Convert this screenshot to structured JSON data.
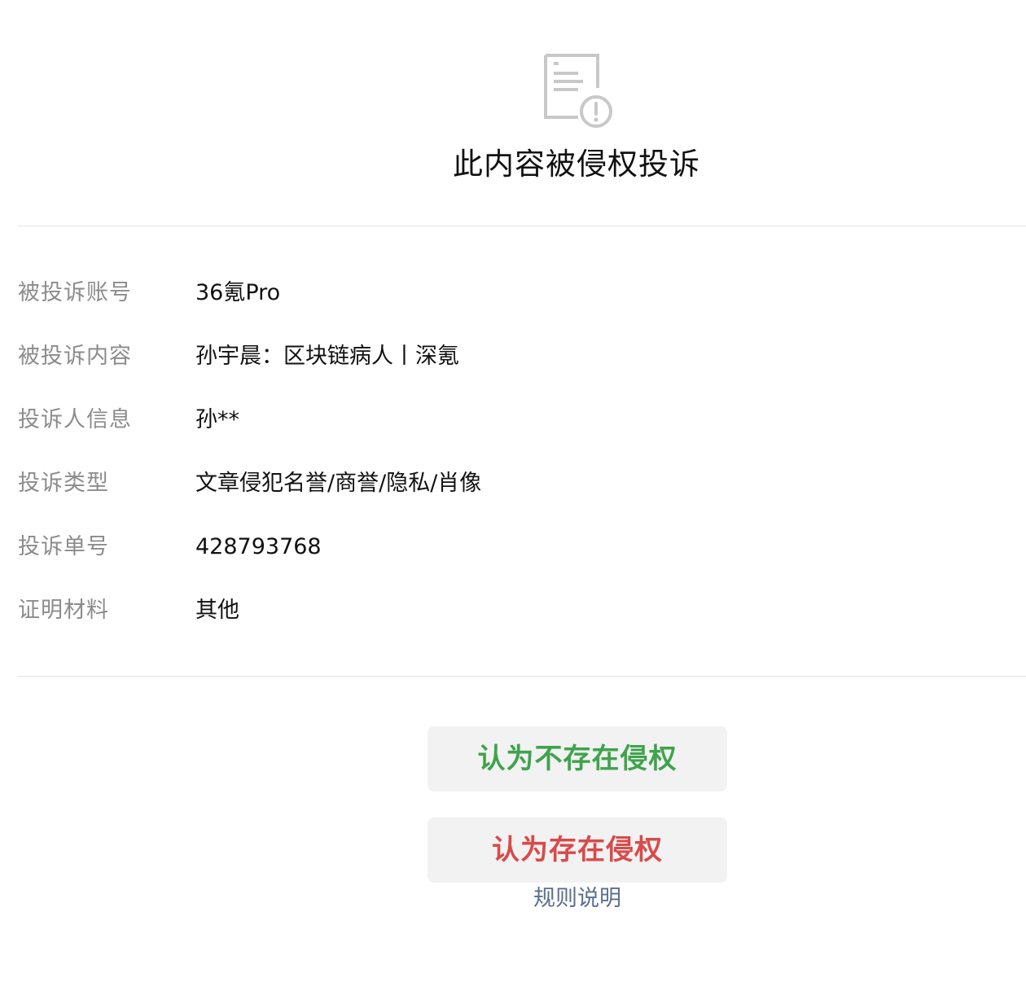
{
  "header": {
    "icon": "document-warning-icon",
    "title": "此内容被侵权投诉"
  },
  "info": {
    "rows": [
      {
        "label": "被投诉账号",
        "value": "36氪Pro"
      },
      {
        "label": "被投诉内容",
        "value": "孙宇晨：区块链病人丨深氪"
      },
      {
        "label": "投诉人信息",
        "value": "孙**"
      },
      {
        "label": "投诉类型",
        "value": "文章侵犯名誉/商誉/隐私/肖像"
      },
      {
        "label": "投诉单号",
        "value": "428793768"
      },
      {
        "label": "证明材料",
        "value": "其他"
      }
    ]
  },
  "actions": {
    "no_infringement_label": "认为不存在侵权",
    "infringement_label": "认为存在侵权",
    "rules_link_label": "规则说明"
  },
  "colors": {
    "green": "#3fa34d",
    "red": "#d94a4a",
    "link": "#5a6f8f",
    "label_gray": "#8c8c8c",
    "button_bg": "#f2f2f2",
    "icon_gray": "#c8c8c8"
  }
}
